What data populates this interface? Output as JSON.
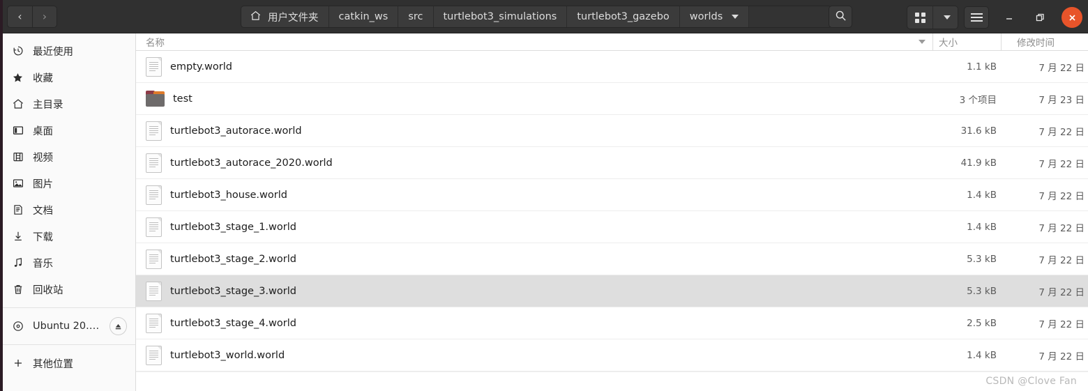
{
  "titlebar": {
    "nav": {
      "back_label": "‹",
      "forward_label": "›"
    },
    "breadcrumbs": [
      {
        "label": "用户文件夹",
        "icon": "home-icon"
      },
      {
        "label": "catkin_ws"
      },
      {
        "label": "src"
      },
      {
        "label": "turtlebot3_simulations"
      },
      {
        "label": "turtlebot3_gazebo"
      },
      {
        "label": "worlds",
        "has_dropdown": true
      }
    ],
    "path_entry_value": "",
    "search_icon": "search-icon",
    "view_grid_icon": "grid-view-icon",
    "view_dropdown_icon": "chevron-down-icon",
    "menu_icon": "hamburger-menu-icon",
    "minimize_label": "–",
    "maximize_label": "❐",
    "close_label": "✕",
    "close_color": "#e8542a"
  },
  "sidebar": {
    "items": [
      {
        "label": "最近使用",
        "icon": "clock-icon",
        "name": "recent"
      },
      {
        "label": "收藏",
        "icon": "star-icon",
        "name": "starred"
      },
      {
        "label": "主目录",
        "icon": "home-icon",
        "name": "home"
      },
      {
        "label": "桌面",
        "icon": "desktop-icon",
        "name": "desktop"
      },
      {
        "label": "视频",
        "icon": "video-icon",
        "name": "videos"
      },
      {
        "label": "图片",
        "icon": "image-icon",
        "name": "pictures"
      },
      {
        "label": "文档",
        "icon": "document-icon",
        "name": "documents"
      },
      {
        "label": "下载",
        "icon": "download-icon",
        "name": "downloads"
      },
      {
        "label": "音乐",
        "icon": "music-icon",
        "name": "music"
      },
      {
        "label": "回收站",
        "icon": "trash-icon",
        "name": "trash"
      }
    ],
    "devices": [
      {
        "label": "Ubuntu 20.0…",
        "icon": "disc-icon",
        "eject_icon": "eject-icon",
        "name": "ubuntu-volume"
      }
    ],
    "other": {
      "label": "其他位置",
      "icon": "plus-icon",
      "name": "other-locations"
    }
  },
  "filelist": {
    "columns": {
      "name": "名称",
      "size": "大小",
      "modified": "修改时间",
      "sort_indicator": "descending"
    },
    "rows": [
      {
        "name": "empty.world",
        "type": "file",
        "size": "1.1 kB",
        "modified": "7 月 22 日",
        "selected": false
      },
      {
        "name": "test",
        "type": "folder",
        "size": "3 个项目",
        "modified": "7 月 23 日",
        "selected": false
      },
      {
        "name": "turtlebot3_autorace.world",
        "type": "file",
        "size": "31.6 kB",
        "modified": "7 月 22 日",
        "selected": false
      },
      {
        "name": "turtlebot3_autorace_2020.world",
        "type": "file",
        "size": "41.9 kB",
        "modified": "7 月 22 日",
        "selected": false
      },
      {
        "name": "turtlebot3_house.world",
        "type": "file",
        "size": "1.4 kB",
        "modified": "7 月 22 日",
        "selected": false
      },
      {
        "name": "turtlebot3_stage_1.world",
        "type": "file",
        "size": "1.4 kB",
        "modified": "7 月 22 日",
        "selected": false
      },
      {
        "name": "turtlebot3_stage_2.world",
        "type": "file",
        "size": "5.3 kB",
        "modified": "7 月 22 日",
        "selected": false
      },
      {
        "name": "turtlebot3_stage_3.world",
        "type": "file",
        "size": "5.3 kB",
        "modified": "7 月 22 日",
        "selected": true
      },
      {
        "name": "turtlebot3_stage_4.world",
        "type": "file",
        "size": "2.5 kB",
        "modified": "7 月 22 日",
        "selected": false
      },
      {
        "name": "turtlebot3_world.world",
        "type": "file",
        "size": "1.4 kB",
        "modified": "7 月 22 日",
        "selected": false
      }
    ]
  },
  "watermark": {
    "text": "CSDN @Clove  Fan"
  }
}
